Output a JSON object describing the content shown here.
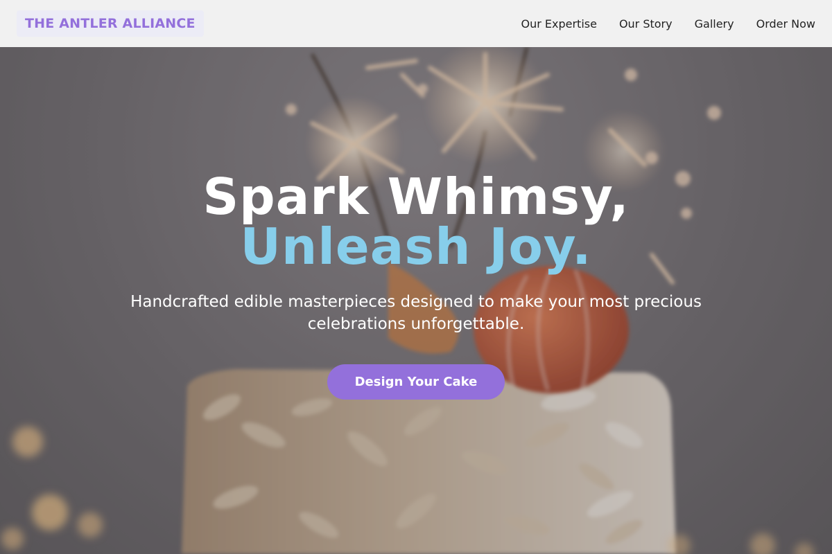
{
  "navbar": {
    "brand": "THE ANTLER ALLIANCE",
    "links": [
      {
        "label": "Our Expertise"
      },
      {
        "label": "Our Story"
      },
      {
        "label": "Gallery"
      },
      {
        "label": "Order Now"
      }
    ]
  },
  "hero": {
    "headline_line1": "Spark Whimsy,",
    "headline_line2": "Unleash Joy.",
    "subtitle": "Handcrafted edible masterpieces designed to make your most precious celebrations unforgettable.",
    "cta_label": "Design Your Cake"
  },
  "colors": {
    "brand": "#9370db",
    "accent": "#87ceeb",
    "navbar_bg": "#f1f1f1",
    "cta_bg": "#9370db"
  }
}
